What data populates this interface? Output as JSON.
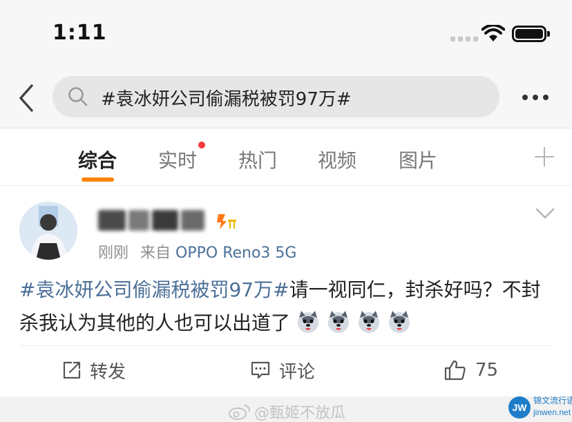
{
  "status_bar": {
    "time": "1:11"
  },
  "search": {
    "query": "#袁冰妍公司偷漏税被罚97万#"
  },
  "tabs": [
    {
      "label": "综合",
      "active": true
    },
    {
      "label": "实时",
      "has_red_dot": true
    },
    {
      "label": "热门"
    },
    {
      "label": "视频"
    },
    {
      "label": "图片"
    }
  ],
  "post": {
    "time": "刚刚",
    "source_prefix": "来自",
    "device": "OPPO Reno3 5G",
    "hashtag": "#袁冰妍公司偷漏税被罚97万#",
    "text": "请一视同仁，封杀好吗？不封杀我认为其他的人也可以出道了",
    "actions": {
      "repost": "转发",
      "comment": "评论",
      "like_count": "75"
    }
  },
  "watermark": {
    "text": "@甄姬不放瓜"
  },
  "site_logo": {
    "mark": "JW",
    "title": "锦文流行语",
    "url": "jinwen.net"
  },
  "colors": {
    "accent_orange": "#ff8200",
    "link_blue": "#4b6f97",
    "notification_red": "#f33a3a"
  }
}
